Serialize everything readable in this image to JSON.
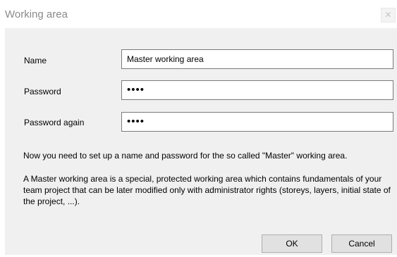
{
  "window": {
    "title": "Working area",
    "close_glyph": "✕"
  },
  "form": {
    "name_label": "Name",
    "name_value": "Master working area",
    "password_label": "Password",
    "password_value": "••••",
    "password_again_label": "Password again",
    "password_again_value": "••••"
  },
  "info": {
    "line1": "Now you need to set up a name and password for the so called \"Master\" working area.",
    "line2": "A Master working area is a special, protected working area which contains fundamentals of your team project that can be later modified only with administrator rights (storeys, layers, initial state of the project, ...)."
  },
  "buttons": {
    "ok": "OK",
    "cancel": "Cancel"
  },
  "icons": {
    "close": "close-icon"
  }
}
